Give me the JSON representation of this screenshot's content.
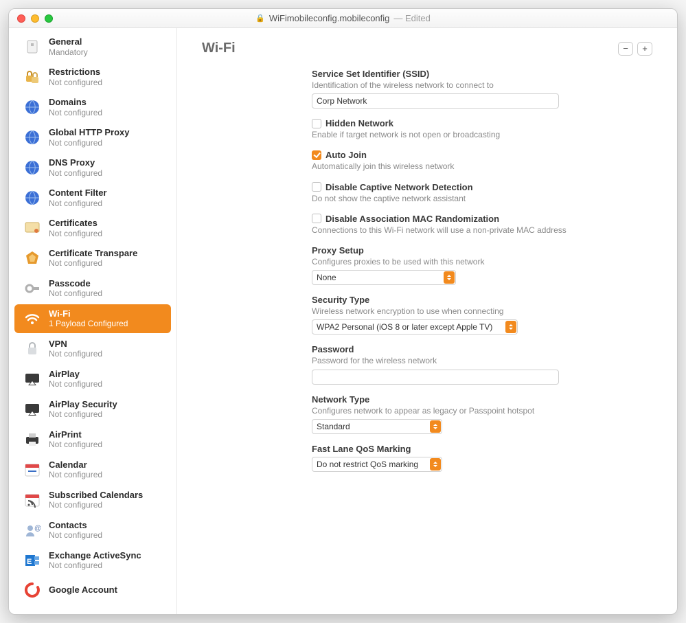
{
  "titlebar": {
    "filename": "WiFimobileconfig.mobileconfig",
    "edited": "— Edited"
  },
  "main": {
    "title": "Wi-Fi",
    "minus": "−",
    "plus": "+"
  },
  "sidebar": [
    {
      "key": "general",
      "title": "General",
      "sub": "Mandatory"
    },
    {
      "key": "restrictions",
      "title": "Restrictions",
      "sub": "Not configured"
    },
    {
      "key": "domains",
      "title": "Domains",
      "sub": "Not configured"
    },
    {
      "key": "http-proxy",
      "title": "Global HTTP Proxy",
      "sub": "Not configured"
    },
    {
      "key": "dns-proxy",
      "title": "DNS Proxy",
      "sub": "Not configured"
    },
    {
      "key": "content-filter",
      "title": "Content Filter",
      "sub": "Not configured"
    },
    {
      "key": "certificates",
      "title": "Certificates",
      "sub": "Not configured"
    },
    {
      "key": "cert-transparency",
      "title": "Certificate Transpare",
      "sub": "Not configured"
    },
    {
      "key": "passcode",
      "title": "Passcode",
      "sub": "Not configured"
    },
    {
      "key": "wifi",
      "title": "Wi-Fi",
      "sub": "1 Payload Configured",
      "selected": true
    },
    {
      "key": "vpn",
      "title": "VPN",
      "sub": "Not configured"
    },
    {
      "key": "airplay",
      "title": "AirPlay",
      "sub": "Not configured"
    },
    {
      "key": "airplay-security",
      "title": "AirPlay Security",
      "sub": "Not configured"
    },
    {
      "key": "airprint",
      "title": "AirPrint",
      "sub": "Not configured"
    },
    {
      "key": "calendar",
      "title": "Calendar",
      "sub": "Not configured"
    },
    {
      "key": "subscribed-calendars",
      "title": "Subscribed Calendars",
      "sub": "Not configured"
    },
    {
      "key": "contacts",
      "title": "Contacts",
      "sub": "Not configured"
    },
    {
      "key": "exchange",
      "title": "Exchange ActiveSync",
      "sub": "Not configured"
    },
    {
      "key": "google",
      "title": "Google Account",
      "sub": ""
    }
  ],
  "form": {
    "ssid": {
      "label": "Service Set Identifier (SSID)",
      "desc": "Identification of the wireless network to connect to",
      "value": "Corp Network"
    },
    "hidden": {
      "label": "Hidden Network",
      "desc": "Enable if target network is not open or broadcasting",
      "checked": false
    },
    "autojoin": {
      "label": "Auto Join",
      "desc": "Automatically join this wireless network",
      "checked": true
    },
    "captive": {
      "label": "Disable Captive Network Detection",
      "desc": "Do not show the captive network assistant",
      "checked": false
    },
    "macrand": {
      "label": "Disable Association MAC Randomization",
      "desc": "Connections to this Wi-Fi network will use a non-private MAC address",
      "checked": false
    },
    "proxy": {
      "label": "Proxy Setup",
      "desc": "Configures proxies to be used with this network",
      "value": "None"
    },
    "security": {
      "label": "Security Type",
      "desc": "Wireless network encryption to use when connecting",
      "value": "WPA2 Personal (iOS 8 or later except Apple TV)"
    },
    "password": {
      "label": "Password",
      "desc": "Password for the wireless network",
      "value": ""
    },
    "nettype": {
      "label": "Network Type",
      "desc": "Configures network to appear as legacy or Passpoint hotspot",
      "value": "Standard"
    },
    "qos": {
      "label": "Fast Lane QoS Marking",
      "value": "Do not restrict QoS marking"
    }
  },
  "iconColors": {
    "general": "#bdbdbd",
    "restrictions": "#e8b44a",
    "domains": "#3b6fd6",
    "http-proxy": "#2f72c6",
    "dns-proxy": "#2f72c6",
    "content-filter": "#2f72c6",
    "certificates": "#d9a64a",
    "cert-transparency": "#e69a2e",
    "passcode": "#b0b0b0",
    "wifi": "#ffffff",
    "vpn": "#9ea3a8",
    "airplay": "#3a3a3a",
    "airplay-security": "#3a3a3a",
    "airprint": "#3a3a3a",
    "calendar": "#e04848",
    "subscribed-calendars": "#e04848",
    "contacts": "#5a7ab0",
    "exchange": "#1f77d0",
    "google": "#e74335"
  }
}
